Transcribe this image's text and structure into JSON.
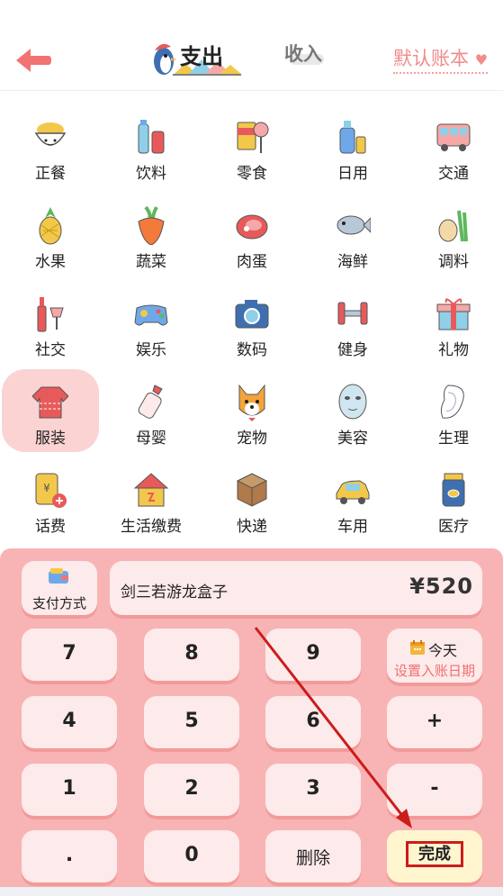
{
  "header": {
    "tab_expense": "支出",
    "tab_income": "收入",
    "account_label": "默认账本",
    "heart": "♥"
  },
  "categories": [
    {
      "label": "正餐",
      "icon": "noodle-bowl-icon"
    },
    {
      "label": "饮料",
      "icon": "drinks-icon"
    },
    {
      "label": "零食",
      "icon": "chips-lollipop-icon"
    },
    {
      "label": "日用",
      "icon": "toiletries-icon"
    },
    {
      "label": "交通",
      "icon": "bus-icon"
    },
    {
      "label": "水果",
      "icon": "pineapple-icon"
    },
    {
      "label": "蔬菜",
      "icon": "carrot-icon"
    },
    {
      "label": "肉蛋",
      "icon": "meat-icon"
    },
    {
      "label": "海鲜",
      "icon": "fish-icon"
    },
    {
      "label": "调料",
      "icon": "seasoning-icon"
    },
    {
      "label": "社交",
      "icon": "wine-icon"
    },
    {
      "label": "娱乐",
      "icon": "gamepad-icon"
    },
    {
      "label": "数码",
      "icon": "camera-icon"
    },
    {
      "label": "健身",
      "icon": "dumbbell-icon"
    },
    {
      "label": "礼物",
      "icon": "gift-icon"
    },
    {
      "label": "服装",
      "icon": "sweater-icon",
      "selected": true
    },
    {
      "label": "母婴",
      "icon": "baby-bottle-icon"
    },
    {
      "label": "宠物",
      "icon": "dog-icon"
    },
    {
      "label": "美容",
      "icon": "face-mask-icon"
    },
    {
      "label": "生理",
      "icon": "sanitary-pad-icon"
    },
    {
      "label": "话费",
      "icon": "phone-bill-icon"
    },
    {
      "label": "生活缴费",
      "icon": "house-utilities-icon"
    },
    {
      "label": "快递",
      "icon": "package-icon"
    },
    {
      "label": "车用",
      "icon": "car-icon"
    },
    {
      "label": "医疗",
      "icon": "medicine-icon"
    }
  ],
  "keypad": {
    "payment_method": "支付方式",
    "memo": "剑三若游龙盒子",
    "amount": "¥520",
    "date_today": "今天",
    "date_hint": "设置入账日期",
    "keys": [
      "7",
      "8",
      "9",
      "4",
      "5",
      "6",
      "+",
      "1",
      "2",
      "3",
      "-",
      ".",
      "0"
    ],
    "delete": "删除",
    "done": "完成"
  },
  "colors": {
    "panel": "#f8b4b4",
    "key": "#fdeaea",
    "accent": "#f07070",
    "highlight": "#cc1c1c"
  }
}
